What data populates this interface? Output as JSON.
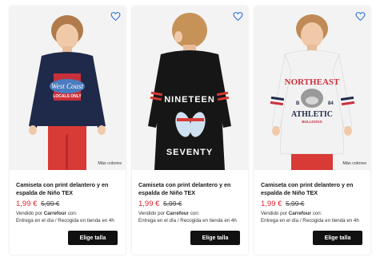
{
  "products": [
    {
      "title": "Camiseta con print delantero y en espalda de Niño TEX",
      "price": "1,99 €",
      "old_price": "5,99 €",
      "seller_prefix": "Vendido por",
      "seller_name": "Carrefour",
      "seller_suffix": "con:",
      "delivery": "Entrega en el día /  Recogida en tienda en 4h",
      "button_label": "Elige talla",
      "more_colors": "Más colores",
      "shirt_print": [
        "LOCALS ONLY"
      ],
      "shirt_color": "#1f2a4a",
      "pants_color": "#d83a35"
    },
    {
      "title": "Camiseta con print delantero y en espalda de Niño TEX",
      "price": "1,99 €",
      "old_price": "5,99 €",
      "seller_prefix": "Vendido por",
      "seller_name": "Carrefour",
      "seller_suffix": "con:",
      "delivery": "Entrega en el día /  Recogida en tienda en 4h",
      "button_label": "Elige talla",
      "more_colors": "",
      "shirt_print": [
        "NINETEEN",
        "SEVENTY"
      ],
      "shirt_color": "#161616",
      "pants_color": "#161616"
    },
    {
      "title": "Camiseta con print delantero y en espalda de Niño TEX",
      "price": "1,99 €",
      "old_price": "5,99 €",
      "seller_prefix": "Vendido por",
      "seller_name": "Carrefour",
      "seller_suffix": "con:",
      "delivery": "Entrega en el día /  Recogida en tienda en 4h",
      "button_label": "Elige talla",
      "more_colors": "Más colores",
      "shirt_print": [
        "NORTHEAST",
        "ATHLETIC",
        "BULLDOGS"
      ],
      "shirt_color": "#f2f2f2",
      "pants_color": "#d83a35"
    }
  ],
  "colors": {
    "price": "#e4232d",
    "button_bg": "#111111",
    "heart_outline": "#2a6fdb"
  },
  "icons": {
    "favorite": "heart-icon"
  }
}
